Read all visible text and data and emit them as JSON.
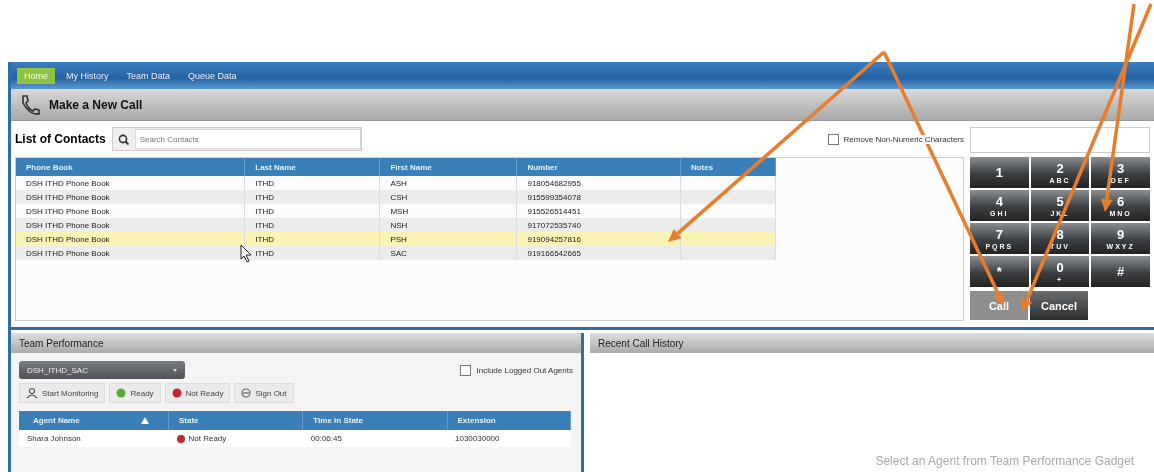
{
  "nav": {
    "tabs": [
      {
        "label": "Home",
        "selected": true
      },
      {
        "label": "My History",
        "selected": false
      },
      {
        "label": "Team Data",
        "selected": false
      },
      {
        "label": "Queue Data",
        "selected": false
      }
    ]
  },
  "call_panel": {
    "title": "Make a New Call",
    "contacts_label": "List of Contacts",
    "search": {
      "placeholder": "Search Contacts"
    },
    "remove_non_numeric": {
      "label": "Remove Non-Numeric Characters",
      "checked": false
    },
    "table": {
      "columns": [
        "Phone Book",
        "Last Name",
        "First Name",
        "Number",
        "Notes"
      ],
      "rows": [
        {
          "cells": [
            "DSH ITHD Phone Book",
            "ITHD",
            "ASH",
            "918054682955",
            ""
          ],
          "selected": false
        },
        {
          "cells": [
            "DSH ITHD Phone Book",
            "ITHD",
            "CSH",
            "915599354078",
            ""
          ],
          "selected": false
        },
        {
          "cells": [
            "DSH ITHD Phone Book",
            "ITHD",
            "MSH",
            "915526514451",
            ""
          ],
          "selected": false
        },
        {
          "cells": [
            "DSH ITHD Phone Book",
            "ITHD",
            "NSH",
            "917072535740",
            ""
          ],
          "selected": false
        },
        {
          "cells": [
            "DSH ITHD Phone Book",
            "ITHD",
            "PSH",
            "919094257816",
            ""
          ],
          "selected": true
        },
        {
          "cells": [
            "DSH ITHD Phone Book",
            "ITHD",
            "SAC",
            "919166542665",
            ""
          ],
          "selected": false
        }
      ]
    },
    "keypad": [
      {
        "digit": "1"
      },
      {
        "digit": "2",
        "letters": "ABC"
      },
      {
        "digit": "3",
        "letters": "DEF"
      },
      {
        "digit": "4",
        "letters": "GHI"
      },
      {
        "digit": "5",
        "letters": "JKL"
      },
      {
        "digit": "6",
        "letters": "MNO"
      },
      {
        "digit": "7",
        "letters": "PQRS"
      },
      {
        "digit": "8",
        "letters": "TUV"
      },
      {
        "digit": "9",
        "letters": "WXYZ"
      },
      {
        "digit": "*"
      },
      {
        "digit": "0",
        "letters": "+"
      },
      {
        "digit": "#"
      }
    ],
    "buttons": [
      {
        "label": "Call",
        "disabled": true
      },
      {
        "label": "Cancel",
        "disabled": false
      }
    ]
  },
  "team_performance": {
    "title": "Team Performance",
    "team_select": "DSH_ITHD_SAC",
    "include_logged_out": {
      "label": "Include Logged Out Agents",
      "checked": false
    },
    "actions": [
      {
        "label": "Start Monitoring",
        "kind": "monitor"
      },
      {
        "label": "Ready",
        "kind": "ready"
      },
      {
        "label": "Not Ready",
        "kind": "notready"
      },
      {
        "label": "Sign Out",
        "kind": "signout"
      }
    ],
    "table": {
      "columns": [
        "Agent Name",
        "State",
        "Time in State",
        "Extension"
      ],
      "rows": [
        {
          "agent": "Shara Johnson",
          "state": "Not Ready",
          "color": "#c0282d",
          "time": "00:06:45",
          "extension": "1030030000"
        }
      ]
    }
  },
  "call_history": {
    "title": "Recent Call History",
    "message": "Select an Agent from Team Performance Gadget"
  }
}
